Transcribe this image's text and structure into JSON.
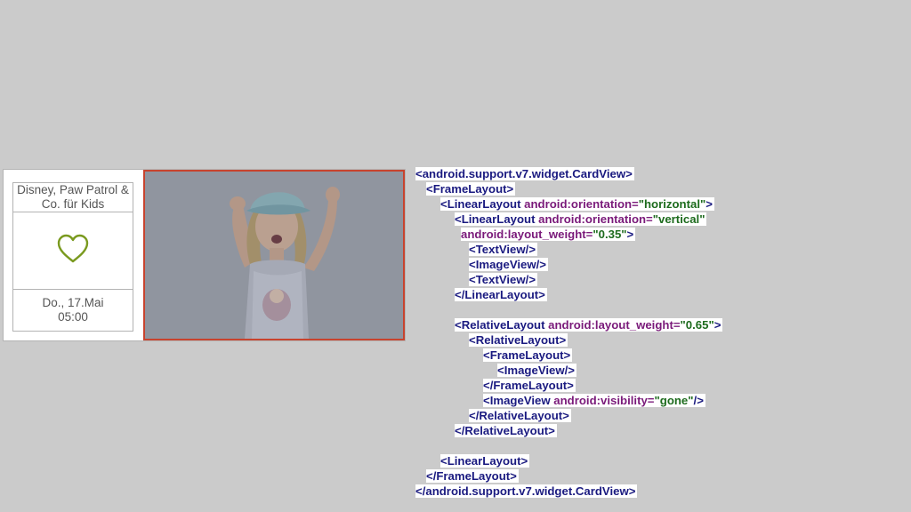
{
  "card": {
    "title_line1": "Disney, Paw Patrol &",
    "title_line2": "Co. für Kids",
    "date": "Do., 17.Mai",
    "time": "05:00",
    "heart_icon": "heart-outline-icon",
    "heart_color": "#7a9a1f",
    "image_border_color": "#c8432e",
    "image_description_icon": "photo-girl-dancing"
  },
  "code": {
    "l1_tag": "<android.support.v7.widget.CardView>",
    "l2_tag": "<FrameLayout>",
    "l3_tag": "<LinearLayout ",
    "l3_attr": "android:orientation=",
    "l3_val": "\"horizontal\"",
    "l3_end": ">",
    "l4_tag": "<LinearLayout ",
    "l4_attr": "android:orientation=",
    "l4_val": "\"vertical\"",
    "l5_attr": "android:layout_weight=",
    "l5_val": "\"0.35\"",
    "l5_end": ">",
    "l6_tag": "<TextView/>",
    "l7_tag": "<ImageView/>",
    "l8_tag": "<TextView/>",
    "l9_tag": "</LinearLayout>",
    "l11_tag": "<RelativeLayout ",
    "l11_attr": "android:layout_weight=",
    "l11_val": "\"0.65\"",
    "l11_end": ">",
    "l12_tag": "<RelativeLayout>",
    "l13_tag": "<FrameLayout>",
    "l14_tag": "<ImageView/>",
    "l15_tag": "</FrameLayout>",
    "l16_tag": "<ImageView ",
    "l16_attr": "android:visibility=",
    "l16_val": "\"gone\"",
    "l16_end": "/>",
    "l17_tag": "</RelativeLayout>",
    "l18_tag": "</RelativeLayout>",
    "l20_tag": "<LinearLayout>",
    "l21_tag": "</FrameLayout>",
    "l22_tag": "</android.support.v7.widget.CardView>"
  }
}
